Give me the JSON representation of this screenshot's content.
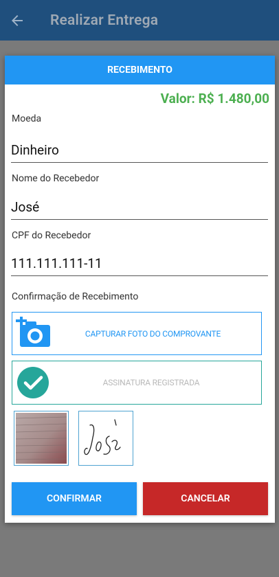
{
  "app_bar": {
    "title": "Realizar Entrega"
  },
  "dialog": {
    "header": "RECEBIMENTO",
    "valor": "Valor: R$ 1.480,00",
    "fields": {
      "moeda": {
        "label": "Moeda",
        "value": "Dinheiro"
      },
      "nome": {
        "label": "Nome do Recebedor",
        "value": "José"
      },
      "cpf": {
        "label": "CPF do Recebedor",
        "value": "111.111.111-11"
      }
    },
    "confirmacao_label": "Confirmação de Recebimento",
    "capture_photo_label": "CAPTURAR FOTO DO COMPROVANTE",
    "signature_label": "ASSINATURA REGISTRADA",
    "confirm_button": "CONFIRMAR",
    "cancel_button": "CANCELAR"
  },
  "colors": {
    "app_bar": "#1f4f7d",
    "primary": "#2196f3",
    "valor": "#4caf50",
    "signature_check": "#26a69a",
    "cancel": "#c62828"
  },
  "icons": {
    "back": "arrow-left-icon",
    "camera": "add-camera-icon",
    "check": "check-circle-icon"
  }
}
